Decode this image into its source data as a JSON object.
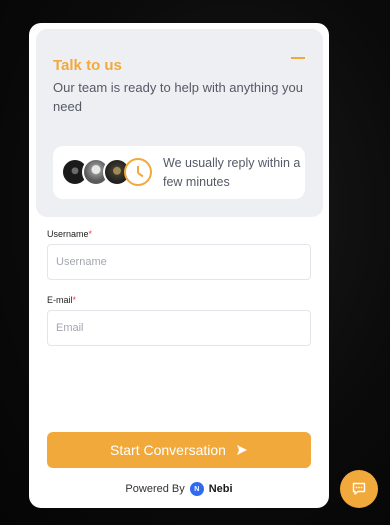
{
  "header": {
    "title": "Talk to us",
    "subtitle": "Our team is ready to help with anything you need",
    "reply_time": "We usually reply within a few minutes"
  },
  "form": {
    "username_label": "Username",
    "username_placeholder": "Username",
    "email_label": "E-mail",
    "email_placeholder": "Email",
    "required_mark": "*"
  },
  "actions": {
    "start_label": "Start Conversation"
  },
  "footer": {
    "powered_by": "Powered By",
    "brand": "Nebi"
  },
  "colors": {
    "accent": "#f2a93b",
    "header_bg": "#eeeff3",
    "brand_blue": "#2f6bf2"
  },
  "icons": [
    "minimize-icon",
    "clock-icon",
    "send-icon",
    "nebi-logo-icon",
    "chat-icon"
  ]
}
